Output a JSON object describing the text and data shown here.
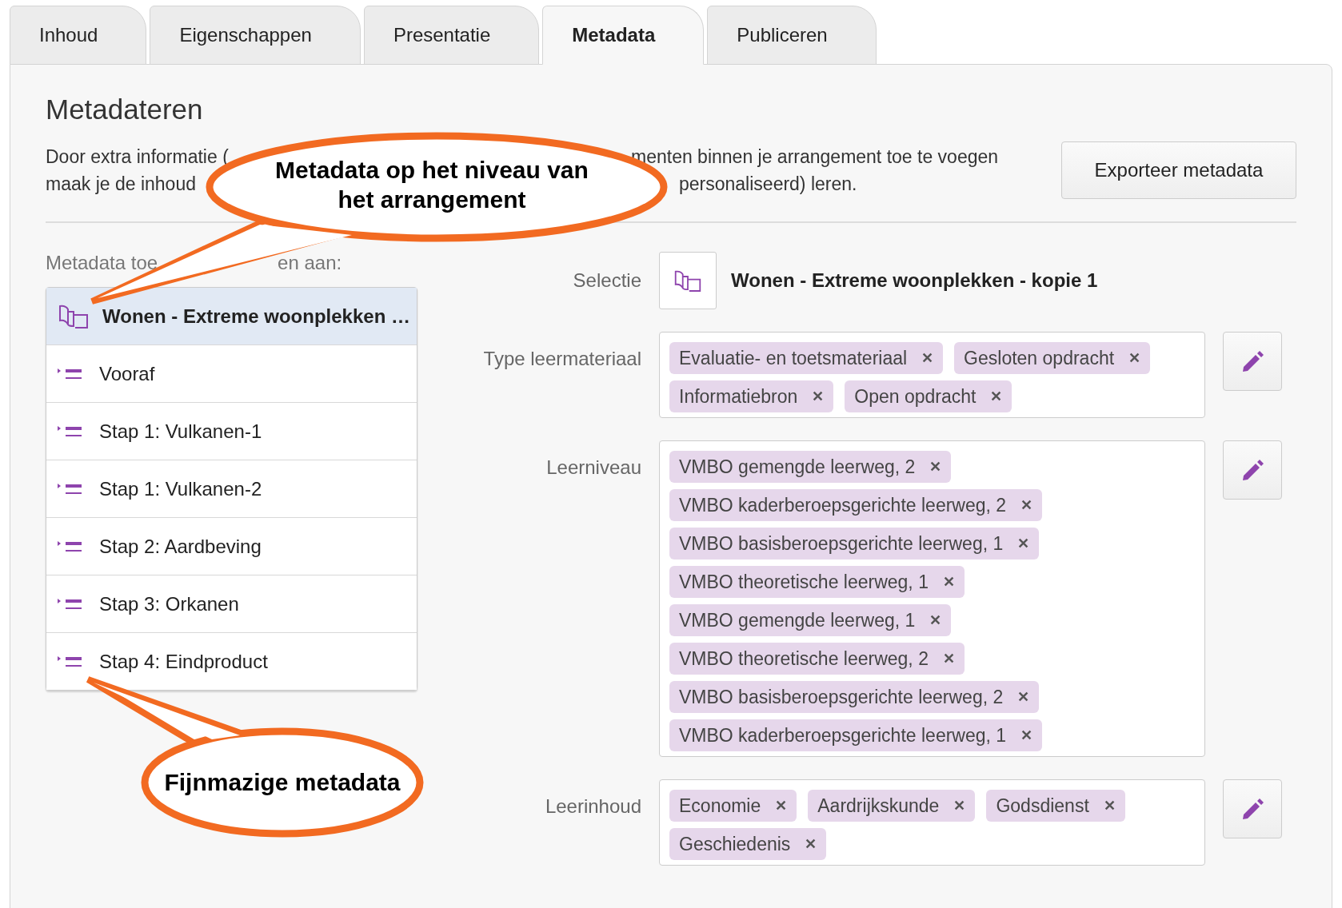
{
  "tabs": [
    {
      "label": "Inhoud",
      "selected": false
    },
    {
      "label": "Eigenschappen",
      "selected": false
    },
    {
      "label": "Presentatie",
      "selected": false
    },
    {
      "label": "Metadata",
      "selected": true
    },
    {
      "label": "Publiceren",
      "selected": false
    }
  ],
  "heading": "Metadateren",
  "intro_lines": [
    [
      "Door extra informatie (",
      "menten binnen je arrangement toe te voegen"
    ],
    [
      "maak je de inhoud",
      "personaliseerd) leren."
    ]
  ],
  "export_button": "Exporteer metadata",
  "tree_label": [
    "Metadata toe",
    "en aan:"
  ],
  "tree": [
    {
      "kind": "arrangement",
      "label": "Wonen - Extreme woonplekken …",
      "selected": true
    },
    {
      "kind": "section",
      "label": "Vooraf",
      "selected": false
    },
    {
      "kind": "section",
      "label": "Stap 1: Vulkanen-1",
      "selected": false
    },
    {
      "kind": "section",
      "label": "Stap 1: Vulkanen-2",
      "selected": false
    },
    {
      "kind": "section",
      "label": "Stap 2: Aardbeving",
      "selected": false
    },
    {
      "kind": "section",
      "label": "Stap 3: Orkanen",
      "selected": false
    },
    {
      "kind": "section",
      "label": "Stap 4: Eindproduct",
      "selected": false
    }
  ],
  "selection": {
    "label": "Selectie",
    "title": "Wonen - Extreme woonplekken - kopie 1"
  },
  "fields": [
    {
      "label": "Type leermateriaal",
      "kind": "wrap",
      "tags": [
        "Evaluatie- en toetsmateriaal",
        "Gesloten opdracht",
        "Informatiebron",
        "Open opdracht"
      ]
    },
    {
      "label": "Leerniveau",
      "kind": "stack",
      "tags": [
        "VMBO gemengde leerweg, 2",
        "VMBO kaderberoepsgerichte leerweg, 2",
        "VMBO basisberoepsgerichte leerweg, 1",
        "VMBO theoretische leerweg, 1",
        "VMBO gemengde leerweg, 1",
        "VMBO theoretische leerweg, 2",
        "VMBO basisberoepsgerichte leerweg, 2",
        "VMBO kaderberoepsgerichte leerweg, 1"
      ]
    },
    {
      "label": "Leerinhoud",
      "kind": "wrap",
      "tags": [
        "Economie",
        "Aardrijkskunde",
        "Godsdienst",
        "Geschiedenis"
      ]
    }
  ],
  "tag_remove": "✕",
  "callouts": [
    "Metadata op het niveau van het arrangement",
    "Fijnmazige metadata"
  ]
}
